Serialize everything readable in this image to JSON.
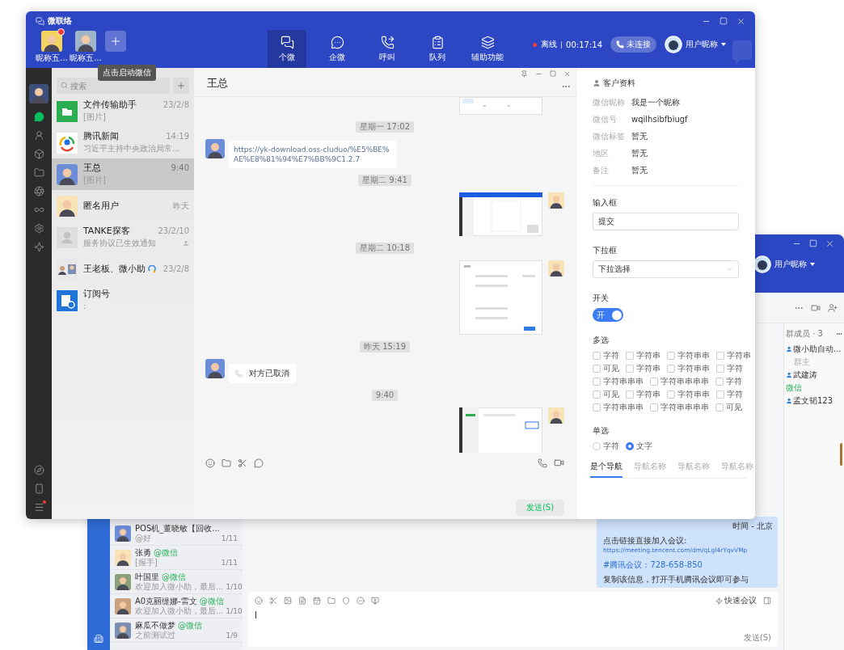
{
  "main_window": {
    "title": "微联络",
    "accounts": [
      {
        "name": "昵称五...",
        "badge": true
      },
      {
        "name": "昵称五...",
        "badge": false
      }
    ],
    "add_tooltip": "点击启动微信",
    "tabs": [
      {
        "label": "个微",
        "kind": "chat",
        "selected": true
      },
      {
        "label": "企微",
        "kind": "work",
        "selected": false
      },
      {
        "label": "呼叫",
        "kind": "call",
        "selected": false
      },
      {
        "label": "队列",
        "kind": "queue",
        "selected": false
      },
      {
        "label": "辅助功能",
        "kind": "tools",
        "selected": false
      }
    ],
    "status": {
      "online": false,
      "label": "离线",
      "timer": "00:17:14"
    },
    "connect_button": "未连接",
    "user_name": "用户昵称",
    "side_nav": [
      {
        "kind": "chat",
        "selected": true
      },
      {
        "kind": "contacts",
        "selected": false
      },
      {
        "kind": "box",
        "selected": false
      },
      {
        "kind": "folder",
        "selected": false
      },
      {
        "kind": "aperture",
        "selected": false
      },
      {
        "kind": "infinity",
        "selected": false
      },
      {
        "kind": "gear",
        "selected": false
      },
      {
        "kind": "sparkle",
        "selected": false
      }
    ],
    "side_nav_bottom": [
      {
        "kind": "compass",
        "badge": false
      },
      {
        "kind": "phone",
        "badge": false
      },
      {
        "kind": "menu",
        "badge": true
      }
    ],
    "search": {
      "placeholder": "搜索"
    },
    "conversations": [
      {
        "kind": "file",
        "name": "文件传输助手",
        "preview": "[图片]",
        "time": "23/2/8",
        "muted": false,
        "work": false,
        "selected": false
      },
      {
        "kind": "news",
        "name": "腾讯新闻",
        "preview": "习近平主持中央政治局常...",
        "time": "14:19",
        "muted": false,
        "work": false,
        "selected": false
      },
      {
        "kind": "figure",
        "name": "王总",
        "preview": "[图片]",
        "time": "9:40",
        "muted": false,
        "work": false,
        "selected": true
      },
      {
        "kind": "figure",
        "name": "匿名用户",
        "time": "昨天",
        "muted": false,
        "work": false,
        "selected": false
      },
      {
        "kind": "placeholder",
        "name": "TANKE探客",
        "preview": "服务协议已生效通知",
        "time": "23/2/10",
        "muted": true,
        "work": false,
        "selected": false
      },
      {
        "kind": "group",
        "name": "王老板、微小助",
        "time": "23/2/8",
        "muted": false,
        "work": true,
        "selected": false
      },
      {
        "kind": "subscription",
        "name": "订阅号",
        "preview": ":",
        "muted": false,
        "work": false,
        "selected": false
      }
    ],
    "chat": {
      "title": "王总",
      "messages": [
        {
          "kind": "snippet"
        },
        {
          "kind": "time",
          "text": "星期一 17:02"
        },
        {
          "kind": "link",
          "text": "https://yk-download.oss-cluduo/%E5%BE%AE%E8%81%94%E7%BB%9C1.2.7"
        },
        {
          "kind": "time",
          "text": "星期二 9:41"
        },
        {
          "kind": "screenshot"
        },
        {
          "kind": "time",
          "text": "星期二 10:18"
        },
        {
          "kind": "form"
        },
        {
          "kind": "time",
          "text": "昨天 15:19"
        },
        {
          "kind": "call",
          "text": "对方已取消"
        },
        {
          "kind": "time",
          "text": "9:40"
        },
        {
          "kind": "window"
        }
      ],
      "send_button": "发送(S)"
    },
    "profile": {
      "title": "客户资料",
      "fields": [
        {
          "label": "微信昵称",
          "value": "我是一个昵称"
        },
        {
          "label": "微信号",
          "value": "wqilhsibfbiugf"
        },
        {
          "label": "微信标签",
          "value": "暂无"
        },
        {
          "label": "地区",
          "value": "暂无"
        },
        {
          "label": "备注",
          "value": "暂无"
        }
      ],
      "input": {
        "label": "输入框",
        "value": "提交"
      },
      "select": {
        "label": "下拉框",
        "value": "下拉选择"
      },
      "switch": {
        "label": "开关",
        "text": "开",
        "on": true
      },
      "multi": {
        "label": "多选",
        "rows": [
          [
            {
              "label": "字符",
              "checked": false
            },
            {
              "label": "字符串",
              "checked": false
            },
            {
              "label": "字符串串",
              "checked": false
            },
            {
              "label": "字符串",
              "checked": false
            }
          ],
          [
            {
              "label": "可见",
              "checked": false
            },
            {
              "label": "字符串",
              "checked": false
            },
            {
              "label": "字符串串",
              "checked": false
            },
            {
              "label": "字符",
              "checked": false
            }
          ],
          [
            {
              "label": "字符串串串",
              "checked": false
            },
            {
              "label": "字符串串串串",
              "checked": false
            },
            {
              "label": "字符",
              "checked": false
            }
          ],
          [
            {
              "label": "可见",
              "checked": false
            },
            {
              "label": "字符串",
              "checked": false
            },
            {
              "label": "字符串串",
              "checked": false
            },
            {
              "label": "字符",
              "checked": false
            }
          ],
          [
            {
              "label": "字符串串串",
              "checked": false
            },
            {
              "label": "字符串串串串",
              "checked": false
            },
            {
              "label": "可见",
              "checked": false
            }
          ]
        ]
      },
      "single": {
        "label": "单选",
        "options": [
          {
            "label": "字符",
            "selected": false
          },
          {
            "label": "文字",
            "selected": true
          }
        ]
      },
      "tabs": [
        {
          "label": "是个导航",
          "selected": true
        },
        {
          "label": "导航名称",
          "selected": false
        },
        {
          "label": "导航名称",
          "selected": false
        },
        {
          "label": "导航名称",
          "selected": false
        }
      ]
    }
  },
  "second_window": {
    "user_name": "用户昵称",
    "members": {
      "title": "群成员 · 3",
      "items": [
        {
          "kind": "member",
          "name": "微小助自动...",
          "role": "群主"
        },
        {
          "kind": "member",
          "name": "武建涛"
        },
        {
          "kind": "section",
          "name": "微信"
        },
        {
          "kind": "member",
          "name": "孟文韬123"
        }
      ]
    },
    "contacts": [
      {
        "name": "POS机_董晓敏【回收...",
        "preview": "@好",
        "time": "1/11"
      },
      {
        "name": "张勇",
        "tag": "@微信",
        "preview": "[握手]",
        "time": "1/11"
      },
      {
        "name": "叶国里",
        "tag": "@微信",
        "preview": "欢迎加入微小助，最后...",
        "time": "1/10"
      },
      {
        "name": "A0克丽缇娜-雷文",
        "tag": "@微信",
        "preview": "欢迎加入微小助，最后...",
        "time": "1/10"
      },
      {
        "name": "麻瓜不做梦",
        "tag": "@微信",
        "preview": "之前测试过",
        "time": "1/9"
      }
    ],
    "meeting_message": [
      [
        {
          "kind": "text",
          "text": "时间 - 北京"
        }
      ],
      [
        {
          "kind": "text",
          "text": "点击链接直接加入会议:"
        },
        {
          "kind": "link",
          "text": "https://meeting.tencent.com/dm/qLgl4rYqvVMp"
        }
      ],
      [
        {
          "kind": "link",
          "text": "#腾讯会议：728-658-850"
        }
      ],
      [
        {
          "kind": "text",
          "text": "复制该信息，打开手机腾讯会议即可参与"
        }
      ]
    ],
    "quick_meeting": "快速会议",
    "send_button": "发送(S)"
  }
}
